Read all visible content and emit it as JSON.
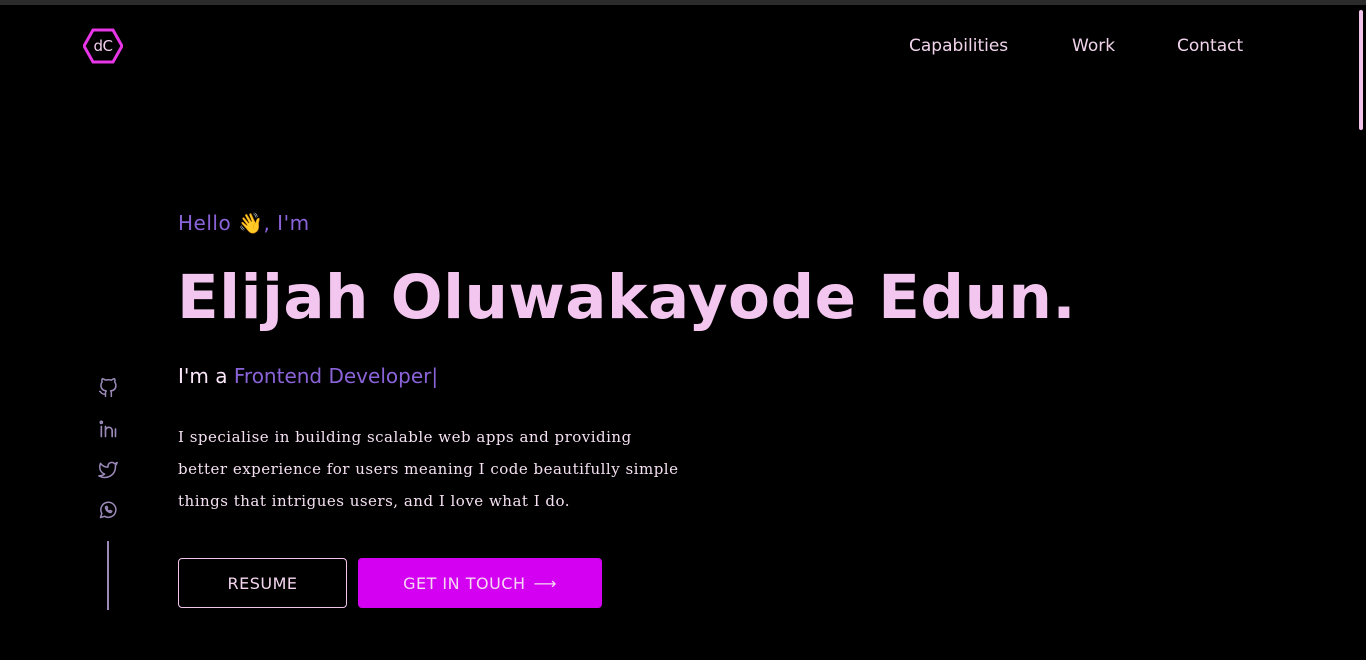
{
  "logo": {
    "text": "dC"
  },
  "nav": {
    "items": [
      {
        "label": "Capabilities"
      },
      {
        "label": "Work"
      },
      {
        "label": "Contact"
      }
    ]
  },
  "hero": {
    "greeting": "Hello",
    "wave_emoji": "👋",
    "greeting_suffix": ", I'm",
    "name": "Elijah Oluwakayode Edun.",
    "role_prefix": "I'm a",
    "role": "Frontend Developer",
    "cursor": "|",
    "bio_lines": [
      "I specialise in building scalable web apps and providing",
      "better experience for users meaning I code beautifully simple",
      "things that intrigues users, and I love what I do."
    ]
  },
  "buttons": {
    "resume": "RESUME",
    "get_in_touch": "GET IN TOUCH",
    "arrow": "⟶"
  },
  "social": [
    {
      "icon": "github-icon"
    },
    {
      "icon": "linkedin-icon"
    },
    {
      "icon": "twitter-icon"
    },
    {
      "icon": "whatsapp-icon"
    }
  ],
  "colors": {
    "background": "#000000",
    "accent_purple": "#8b63d9",
    "name_pink": "#f3c6ef",
    "cta_magenta": "#d400f2",
    "logo_hex": "#e636e6"
  }
}
